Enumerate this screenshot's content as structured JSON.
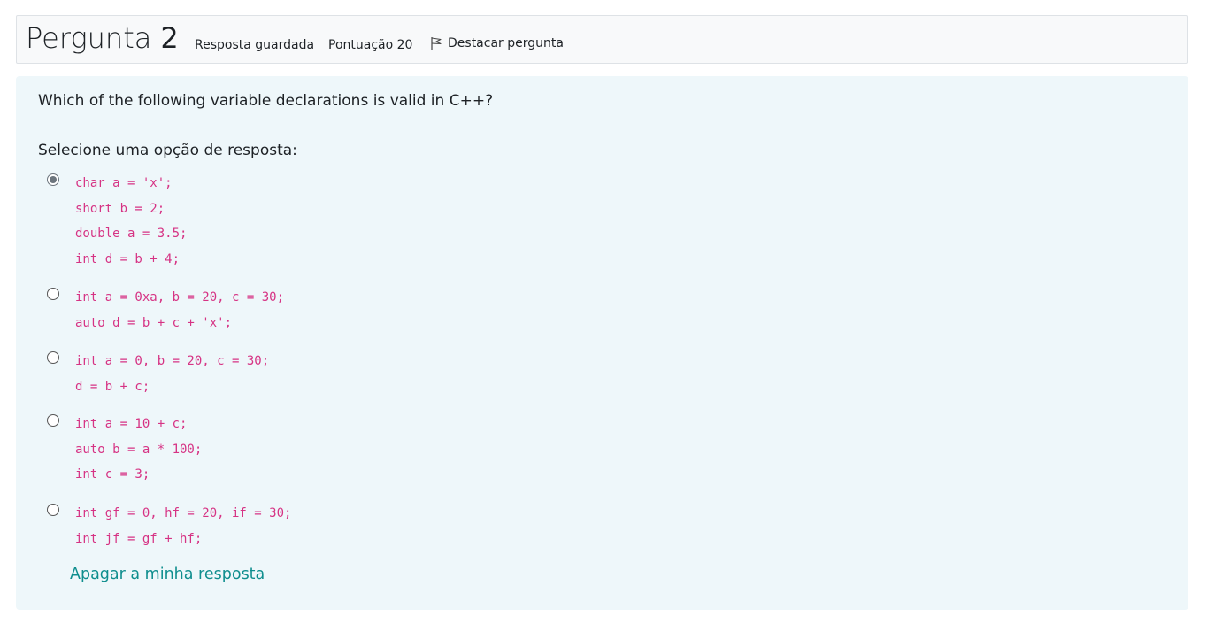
{
  "question": {
    "label": "Pergunta",
    "number": "2",
    "state": "Resposta guardada",
    "grade": "Pontuação 20",
    "flag_label": "Destacar pergunta",
    "text": "Which of the following variable declarations is valid in C++?",
    "prompt": "Selecione uma opção de resposta:",
    "options": [
      {
        "checked": true,
        "lines": [
          "char a = 'x';",
          "short b = 2;",
          "double a = 3.5;",
          "int d = b + 4;"
        ]
      },
      {
        "checked": false,
        "lines": [
          "int a = 0xa, b = 20, c = 30;",
          "auto d = b + c + 'x';"
        ]
      },
      {
        "checked": false,
        "lines": [
          "int a = 0, b = 20, c = 30;",
          "d = b + c;"
        ]
      },
      {
        "checked": false,
        "lines": [
          "int a = 10 + c;",
          "auto b = a * 100;",
          "int c = 3;"
        ]
      },
      {
        "checked": false,
        "lines": [
          "int gf = 0, hf = 20, if = 30;",
          "int jf = gf + hf;"
        ]
      }
    ],
    "clear_label": "Apagar a minha resposta"
  },
  "colors": {
    "code": "#d63384",
    "link": "#0f8e8e",
    "panel": "#eef7fa",
    "info_bar": "#f8f9fa"
  },
  "icons": {
    "flag": "flag-outline-icon"
  }
}
